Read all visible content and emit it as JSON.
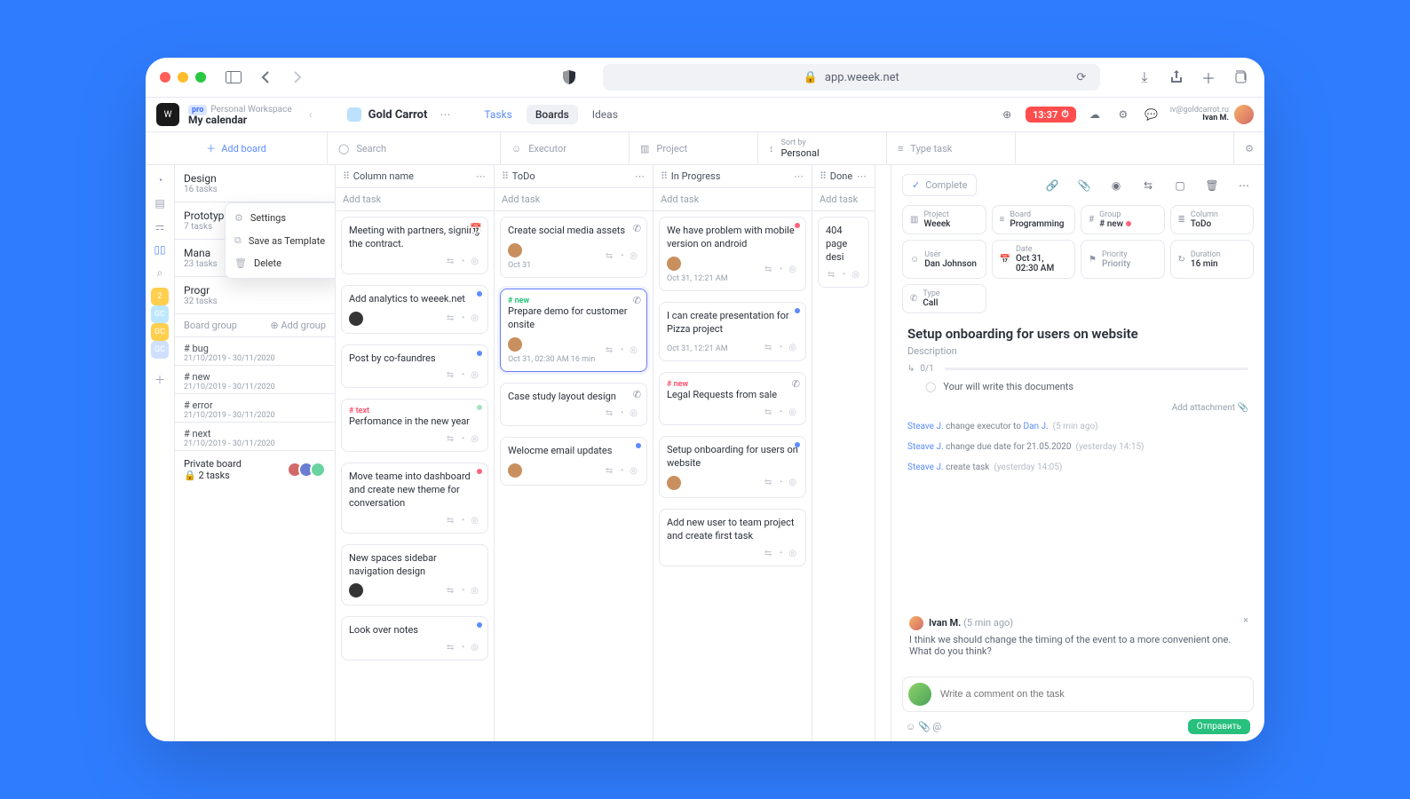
{
  "chrome": {
    "url_host": "app.weeek.net"
  },
  "topbar": {
    "pro": "pro",
    "ws_label": "Personal Workspace",
    "ws_name": "My calendar",
    "project": "Gold Carrot",
    "views": [
      "Tasks",
      "Boards",
      "Ideas"
    ],
    "timer": "13:37",
    "user_email": "iv@goldcarrot.ru",
    "user_name": "Ivan M."
  },
  "filters": {
    "add_board": "Add board",
    "search": "Search",
    "executor": "Executor",
    "project": "Project",
    "sort_label": "Sort by",
    "sort_value": "Personal",
    "type": "Type task"
  },
  "rail_chips": [
    {
      "txt": "2",
      "bg": "#ffcf4d"
    },
    {
      "txt": "GC",
      "bg": "#bde7ff"
    },
    {
      "txt": "GC",
      "bg": "#ffcf4d"
    },
    {
      "txt": "GC",
      "bg": "#cfe0ff"
    }
  ],
  "boards": [
    {
      "name": "Design",
      "sub": "16 tasks"
    },
    {
      "name": "Prototype",
      "sub": "7 tasks",
      "dots": true,
      "menu": true
    },
    {
      "name": "Mana",
      "sub": "23 tasks"
    },
    {
      "name": "Progr",
      "sub": "32 tasks"
    }
  ],
  "board_menu": [
    "Settings",
    "Save as Template",
    "Delete"
  ],
  "board_group": {
    "label": "Board group",
    "add": "Add group"
  },
  "tags": [
    {
      "n": "# bug",
      "d": "21/10/2019 - 30/11/2020"
    },
    {
      "n": "# new",
      "d": "21/10/2019 - 30/11/2020"
    },
    {
      "n": "# error",
      "d": "21/10/2019 - 30/11/2020"
    },
    {
      "n": "# next",
      "d": "21/10/2019 - 30/11/2020"
    }
  ],
  "private": {
    "name": "Private board",
    "sub": "2 tasks"
  },
  "columns": [
    {
      "name": "Column name",
      "add": "Add task",
      "cards": [
        {
          "t": "Meeting with partners, signing the contract.",
          "ric": "cal",
          "col": "#5b8cff"
        },
        {
          "t": "Add analytics to weeek.net",
          "dot": "#5b8cff",
          "av": "#353535"
        },
        {
          "t": "Post by co-faundres",
          "dot": "#5b8cff"
        },
        {
          "lbl": "# text",
          "lblc": "red",
          "t": "Perfomance in the new year",
          "dot": "#a7e3c0"
        },
        {
          "t": "Move teame into dashboard and create new theme for conversation",
          "dot": "#ff647c"
        },
        {
          "t": "New spaces sidebar navigation design",
          "av": "#353535"
        },
        {
          "t": "Look over notes",
          "dot": "#5b8cff"
        }
      ]
    },
    {
      "name": "ToDo",
      "add": "Add task",
      "cards": [
        {
          "t": "Create social media assets",
          "ric": "call",
          "meta": "Oct 31",
          "av": "#c98f5e"
        },
        {
          "sel": true,
          "lbl": "# new",
          "lblc": "green",
          "t": "Prepare demo for customer onsite",
          "ric": "call",
          "meta": "Oct 31, 02:30 AM 16 min",
          "av": "#c98f5e"
        },
        {
          "t": "Case study layout design",
          "ric": "call"
        },
        {
          "t": "Welocme email updates",
          "dot": "#5b8cff",
          "av": "#c98f5e"
        }
      ]
    },
    {
      "name": "In Progress",
      "add": "Add task",
      "cards": [
        {
          "t": "We have problem with mobile version on android",
          "dot": "#ff647c",
          "meta": "Oct 31, 12:21 AM",
          "av": "#c98f5e"
        },
        {
          "t": "I can create presentation for Pizza project",
          "dot": "#5b8cff",
          "meta": "Oct 31, 12:21 AM"
        },
        {
          "lbl": "# new",
          "lblc": "red",
          "t": "Legal Requests from sale",
          "ric": "call",
          "dot_extra": "#ffd24d"
        },
        {
          "t": "Setup onboarding for users on website",
          "dot": "#5b8cff",
          "av": "#c98f5e"
        },
        {
          "t": "Add new user to team project and create first task"
        }
      ]
    },
    {
      "name": "Done",
      "add": "Add task",
      "cards": [
        {
          "t": "404 page desi"
        }
      ]
    }
  ],
  "detail": {
    "complete": "Complete",
    "props": [
      {
        "k": "Project",
        "v": "Weeek",
        "ic": "proj"
      },
      {
        "k": "Board",
        "v": "Programming",
        "ic": "board"
      },
      {
        "k": "Group",
        "v": "# new",
        "ic": "group",
        "dot": "#ff647c"
      },
      {
        "k": "Column",
        "v": "ToDo",
        "ic": "col"
      },
      {
        "k": "User",
        "v": "Dan Johnson",
        "ic": "user"
      },
      {
        "k": "Date",
        "v": "Oct 31, 02:30 AM",
        "ic": "date"
      },
      {
        "k": "Priority",
        "v": "Priority",
        "ic": "prio",
        "muted": true
      },
      {
        "k": "Duration",
        "v": "16 min",
        "ic": "dur"
      },
      {
        "k": "Type",
        "v": "Call",
        "ic": "type"
      }
    ],
    "title": "Setup onboarding for users on website",
    "desc": "Description",
    "sub_count": "0/1",
    "sub_item": "Your will write this documents",
    "attach": "Add attachment",
    "log": [
      {
        "who": "Steave J.",
        "what": "change executor to",
        "link": "Dan J.",
        "when": "(5 min ago)"
      },
      {
        "who": "Steave J.",
        "what": "change due date for 21.05.2020",
        "when": "(yesterday 14:15)"
      },
      {
        "who": "Steave J.",
        "what": "create task",
        "when": "(yesterday 14:05)"
      }
    ],
    "comment": {
      "who": "Ivan M.",
      "when": "(5 min ago)",
      "body1": "I think we should change the timing of the event to a more convenient one.",
      "body2": "What do you think?"
    },
    "compose_ph": "Write a comment on the task",
    "send": "Отправить"
  }
}
